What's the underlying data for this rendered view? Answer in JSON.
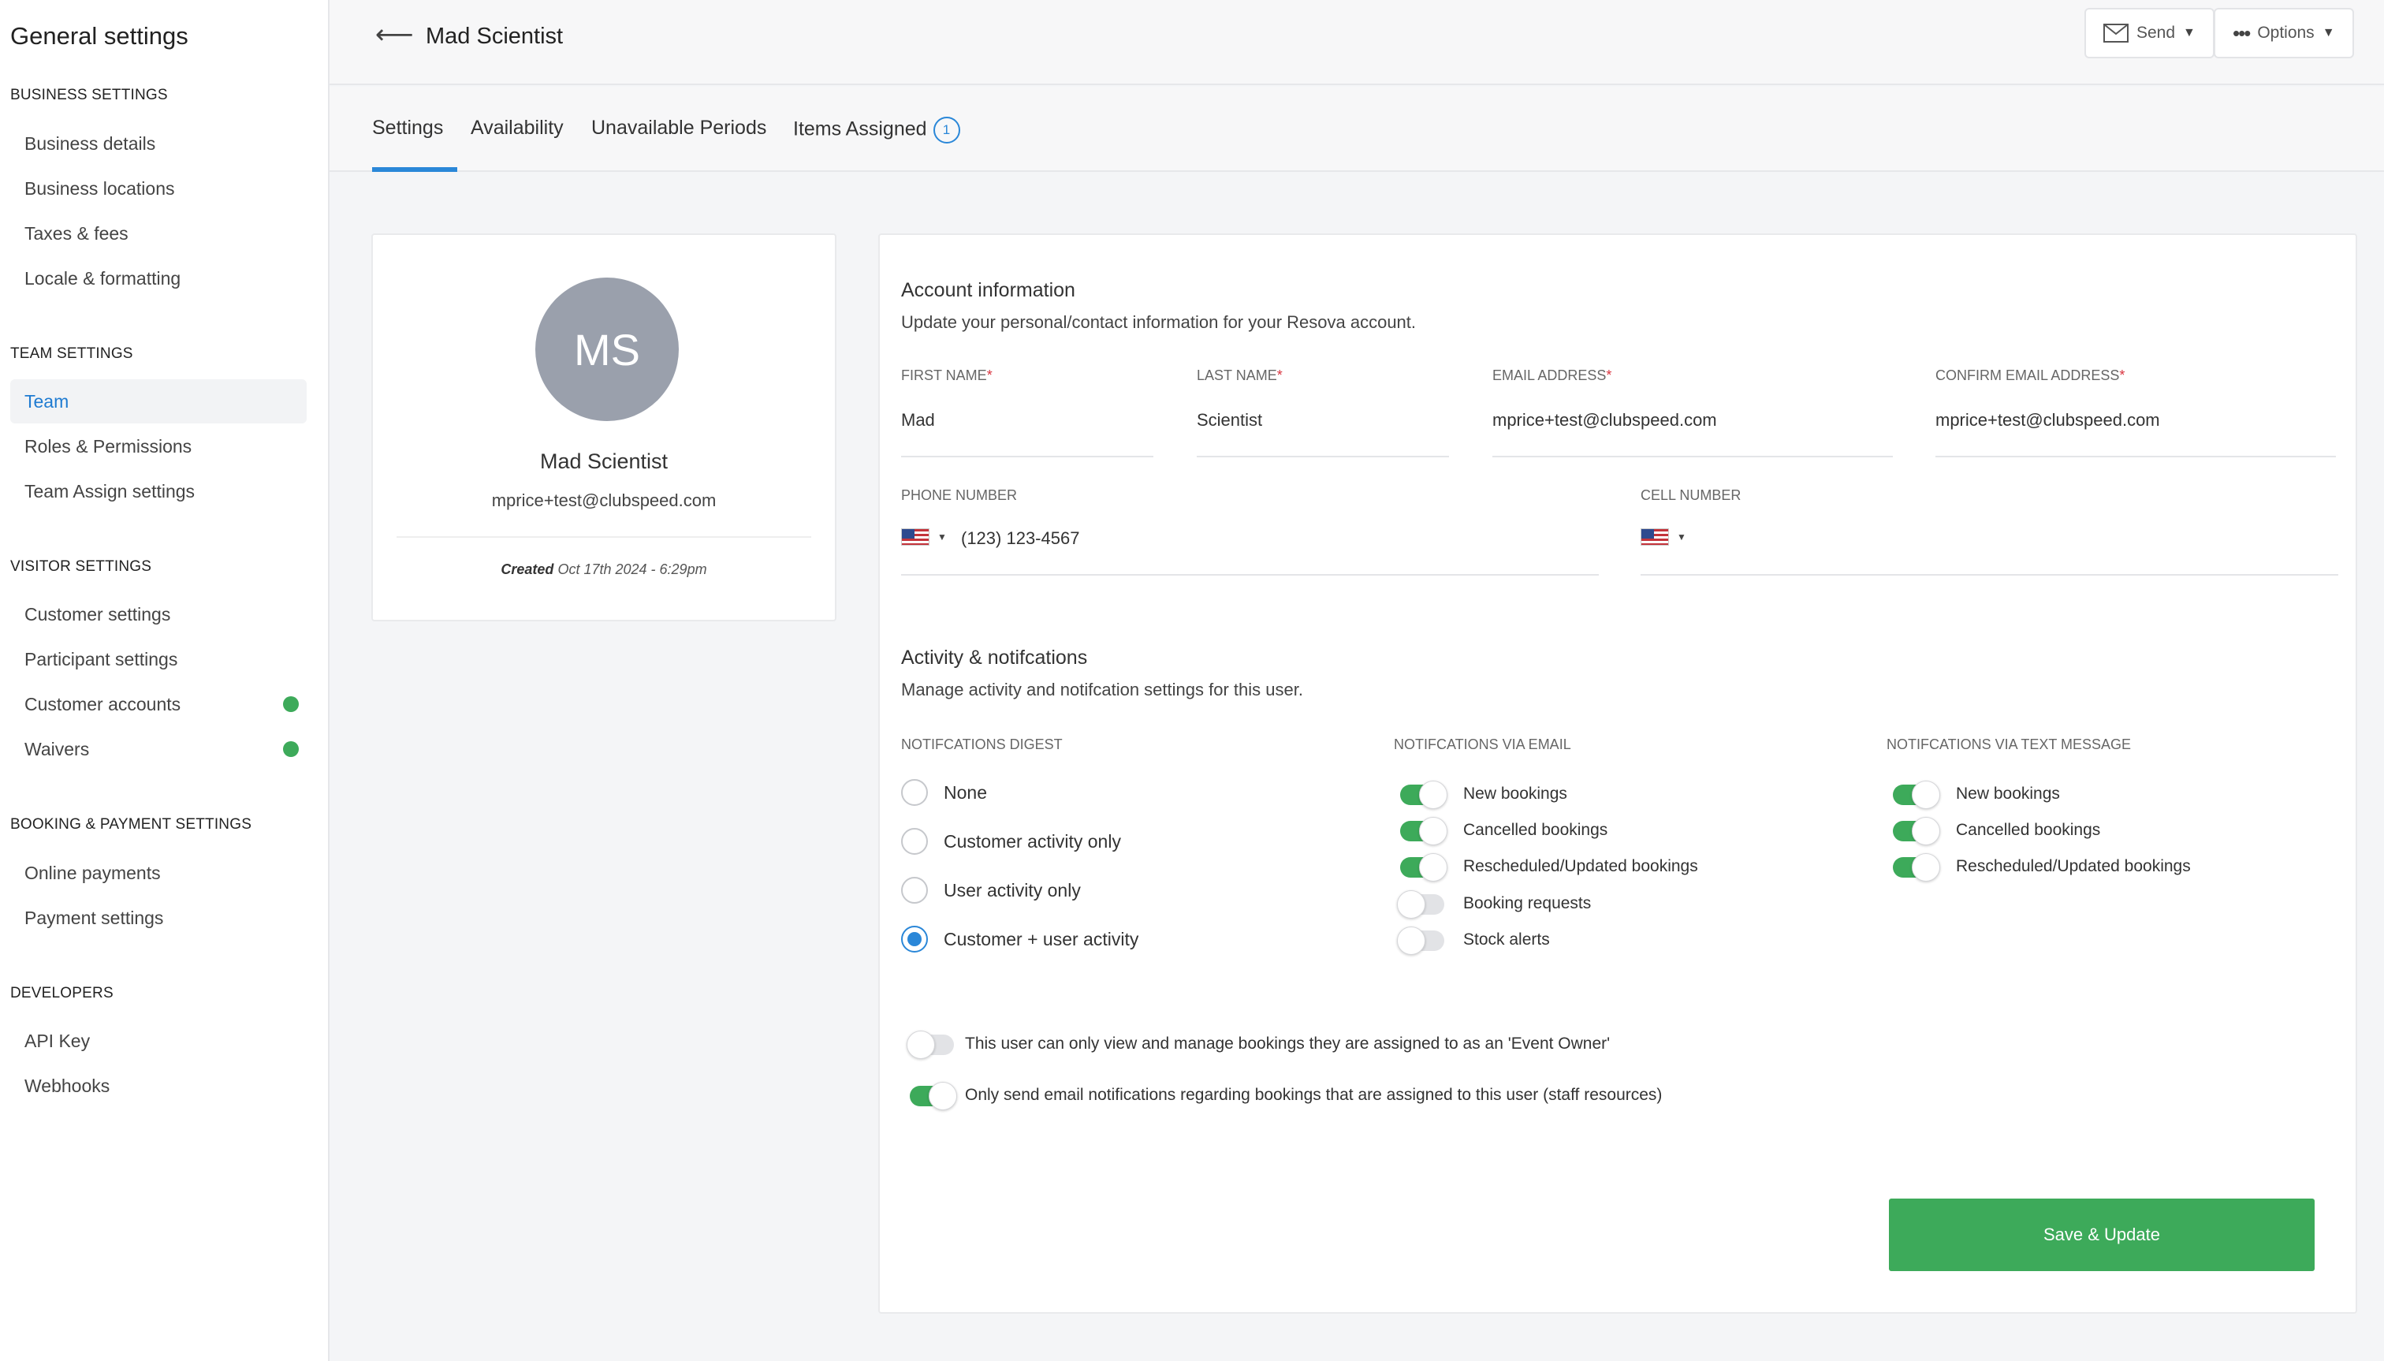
{
  "sidebar": {
    "title": "General settings",
    "sections": [
      {
        "heading": "BUSINESS SETTINGS",
        "items": [
          {
            "label": "Business details"
          },
          {
            "label": "Business locations"
          },
          {
            "label": "Taxes & fees"
          },
          {
            "label": "Locale & formatting"
          }
        ]
      },
      {
        "heading": "TEAM SETTINGS",
        "items": [
          {
            "label": "Team",
            "active": true
          },
          {
            "label": "Roles & Permissions"
          },
          {
            "label": "Team Assign settings"
          }
        ]
      },
      {
        "heading": "VISITOR SETTINGS",
        "items": [
          {
            "label": "Customer settings"
          },
          {
            "label": "Participant settings"
          },
          {
            "label": "Customer accounts",
            "status": "green-dot"
          },
          {
            "label": "Waivers",
            "status": "green-dot"
          }
        ]
      },
      {
        "heading": "BOOKING & PAYMENT SETTINGS",
        "items": [
          {
            "label": "Online payments"
          },
          {
            "label": "Payment settings"
          }
        ]
      },
      {
        "heading": "DEVELOPERS",
        "items": [
          {
            "label": "API Key"
          },
          {
            "label": "Webhooks"
          }
        ]
      }
    ]
  },
  "header": {
    "back_icon": "arrow-left-icon",
    "title": "Mad Scientist",
    "send_label": "Send",
    "options_label": "Options"
  },
  "tabs": [
    {
      "label": "Settings",
      "active": true
    },
    {
      "label": "Availability"
    },
    {
      "label": "Unavailable Periods"
    },
    {
      "label": "Items Assigned",
      "badge": "1"
    }
  ],
  "profile": {
    "initials": "MS",
    "name": "Mad Scientist",
    "email": "mprice+test@clubspeed.com",
    "created_label": "Created",
    "created_value": "Oct 17th 2024 - 6:29pm"
  },
  "account": {
    "title": "Account information",
    "subtitle": "Update your personal/contact information for your Resova account.",
    "first_name_label": "FIRST NAME",
    "first_name": "Mad",
    "last_name_label": "LAST NAME",
    "last_name": "Scientist",
    "email_label": "EMAIL ADDRESS",
    "email": "mprice+test@clubspeed.com",
    "confirm_email_label": "CONFIRM EMAIL ADDRESS",
    "confirm_email": "mprice+test@clubspeed.com",
    "phone_label": "PHONE NUMBER",
    "phone": "(123) 123-4567",
    "cell_label": "CELL NUMBER",
    "cell": "",
    "required_mark": "*"
  },
  "activity": {
    "title": "Activity & notifcations",
    "subtitle": "Manage activity and notifcation settings for this user.",
    "digest_label": "NOTIFCATIONS DIGEST",
    "digest_options": [
      {
        "label": "None",
        "selected": false
      },
      {
        "label": "Customer activity only",
        "selected": false
      },
      {
        "label": "User activity only",
        "selected": false
      },
      {
        "label": "Customer + user activity",
        "selected": true
      }
    ],
    "email_label": "NOTIFCATIONS VIA EMAIL",
    "email_toggles": [
      {
        "label": "New bookings",
        "on": true
      },
      {
        "label": "Cancelled bookings",
        "on": true
      },
      {
        "label": "Rescheduled/Updated bookings",
        "on": true
      },
      {
        "label": "Booking requests",
        "on": false
      },
      {
        "label": "Stock alerts",
        "on": false
      }
    ],
    "text_label": "NOTIFCATIONS VIA TEXT MESSAGE",
    "text_toggles": [
      {
        "label": "New bookings",
        "on": true
      },
      {
        "label": "Cancelled bookings",
        "on": true
      },
      {
        "label": "Rescheduled/Updated bookings",
        "on": true
      }
    ],
    "event_owner_label": "This user can only view and manage bookings they are assigned to as an 'Event Owner'",
    "event_owner_on": false,
    "staff_only_label": "Only send email notifications regarding bookings that are assigned to this user (staff resources)",
    "staff_only_on": true
  },
  "save_label": "Save & Update",
  "colors": {
    "accent": "#2a87d8",
    "success": "#3daa5a",
    "required": "#d9343f"
  }
}
